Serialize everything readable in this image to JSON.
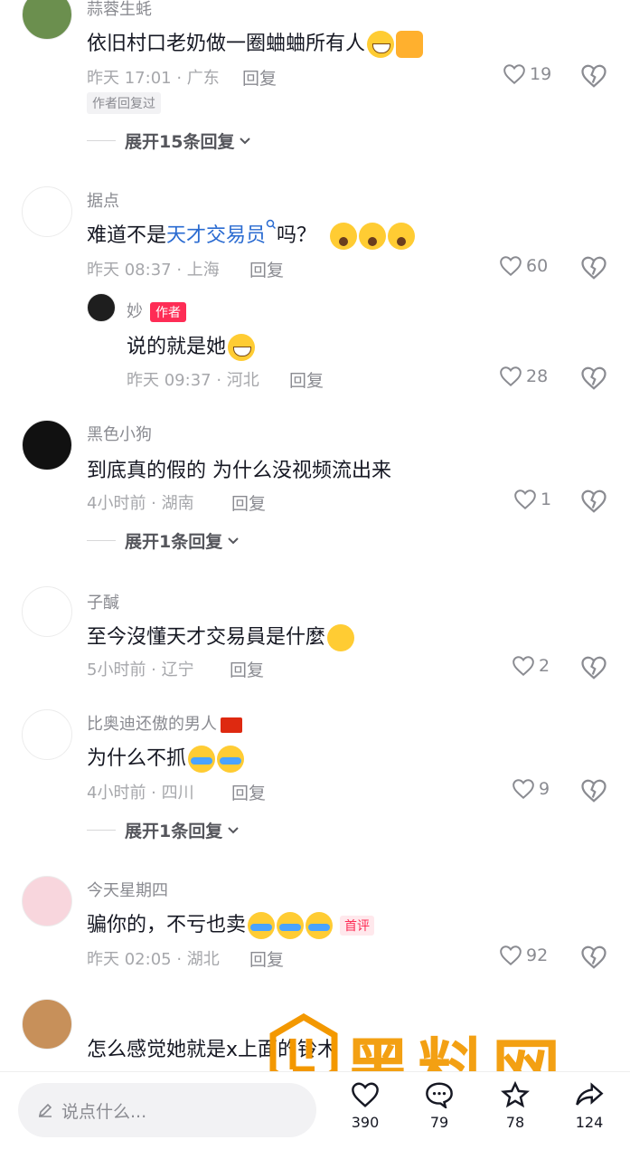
{
  "comments": [
    {
      "username": "蒜蓉生蚝",
      "text": "依旧村口老奶做一圈蛐蛐所有人",
      "time_location": "昨天 17:01 · 广东",
      "reply_label": "回复",
      "likes": "19",
      "tag": "作者回复过",
      "expand": "展开15条回复"
    },
    {
      "username": "据点",
      "text_before": "难道不是",
      "link_text": "天才交易员",
      "text_after": "吗？",
      "time_location": "昨天 08:37 · 上海",
      "reply_label": "回复",
      "likes": "60",
      "reply": {
        "username": "妙",
        "author_tag": "作者",
        "text": "说的就是她",
        "time_location": "昨天 09:37 · 河北",
        "reply_label": "回复",
        "likes": "28"
      }
    },
    {
      "username": "黑色小狗",
      "text": "到底真的假的 为什么没视频流出来",
      "time_location": "4小时前 · 湖南",
      "reply_label": "回复",
      "likes": "1",
      "expand": "展开1条回复"
    },
    {
      "username": "子醎",
      "text": "至今沒懂天才交易員是什麼",
      "time_location": "5小时前 · 辽宁",
      "reply_label": "回复",
      "likes": "2"
    },
    {
      "username": "比奥迪还傲的男人",
      "text": "为什么不抓",
      "time_location": "4小时前 · 四川",
      "reply_label": "回复",
      "likes": "9",
      "expand": "展开1条回复"
    },
    {
      "username": "今天星期四",
      "text": "骗你的，不亏也卖",
      "first_tag": "首评",
      "time_location": "昨天 02:05 · 湖北",
      "reply_label": "回复",
      "likes": "92"
    },
    {
      "text": "怎么感觉她就是x上面的铃木"
    }
  ],
  "bottom_bar": {
    "input_placeholder": "说点什么...",
    "like_count": "390",
    "comment_count": "79",
    "favorite_count": "78",
    "share_count": "124"
  },
  "watermark": {
    "title": "黑料网",
    "url": "https://hlwe16.com"
  },
  "colors": {
    "accent": "#fe2c55",
    "link": "#2a6bd1",
    "watermark": "#f39800"
  }
}
